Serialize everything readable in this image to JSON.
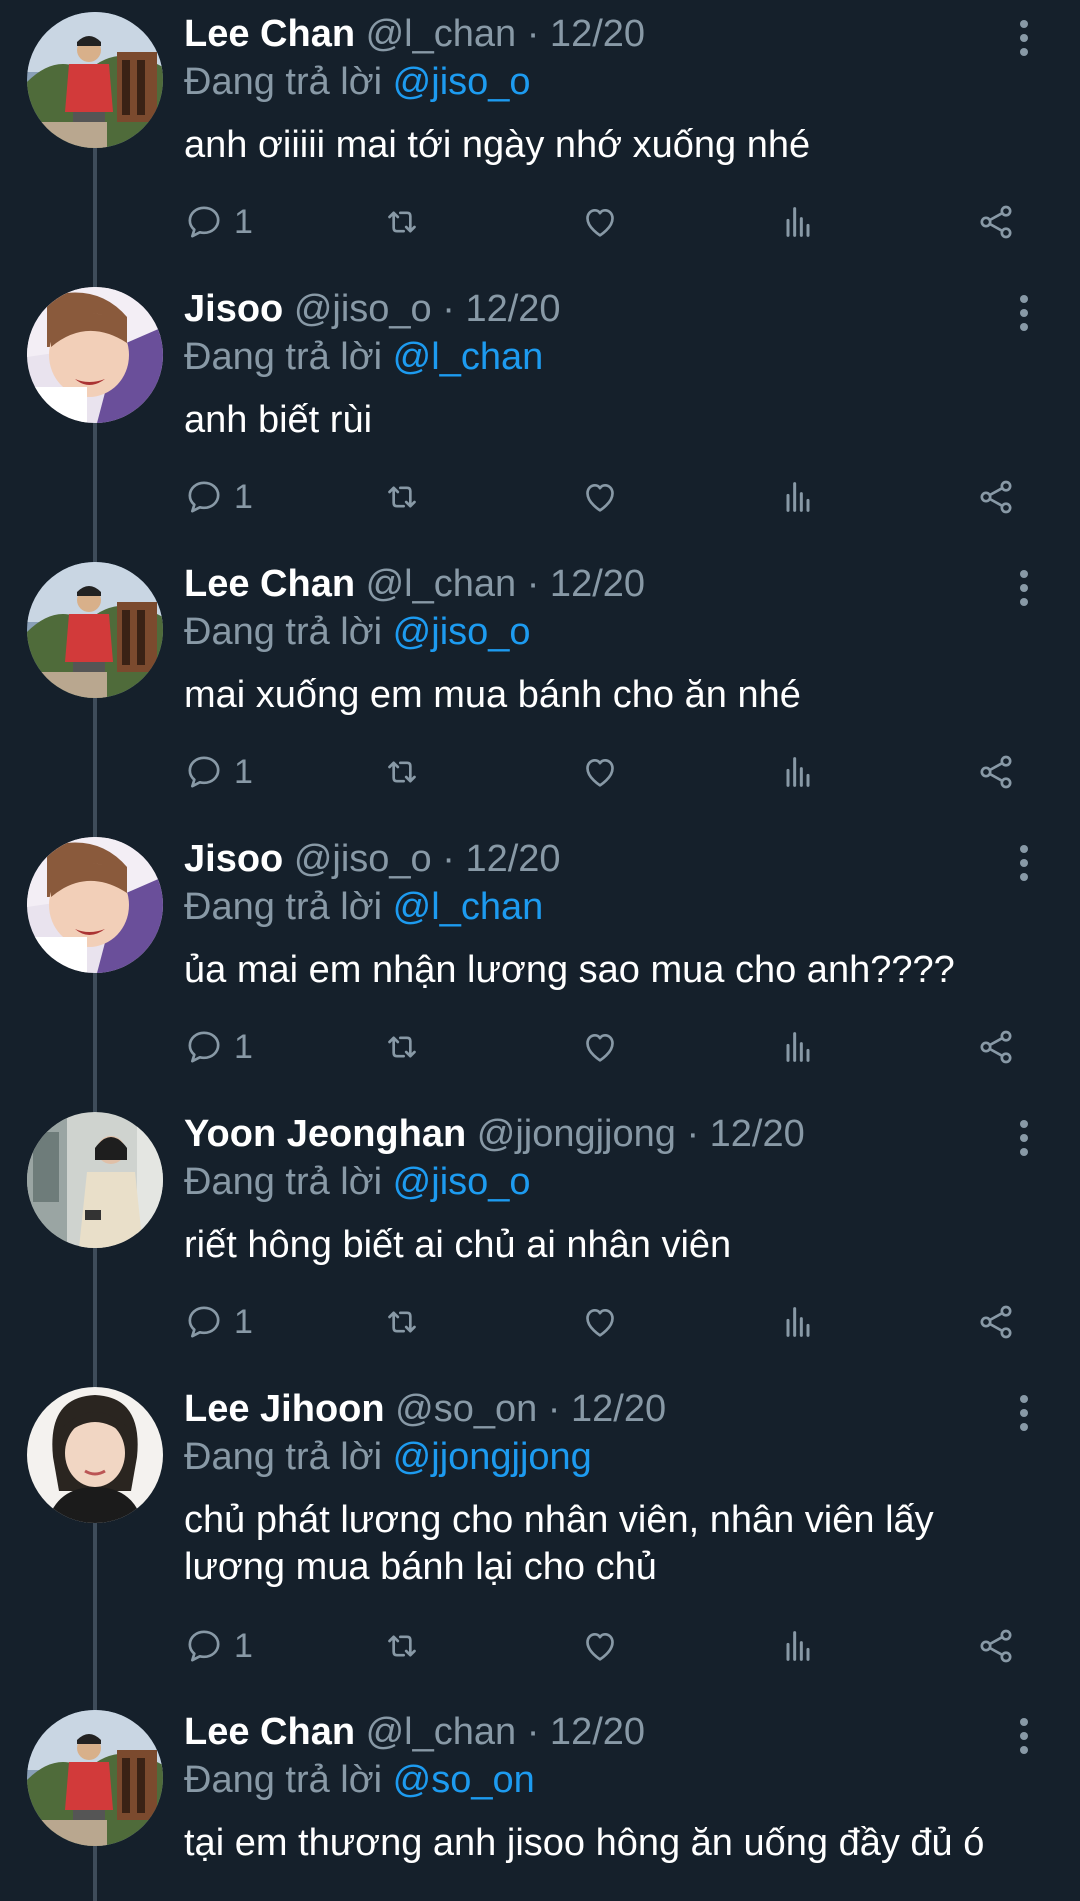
{
  "reply_prefix": "Đang trả lời",
  "tweets": [
    {
      "name": "Lee Chan",
      "meta": "@l_chan · 12/20",
      "reply_to": "@jiso_o",
      "text": "anh ơiiiii mai tới ngày nhớ xuống nhé",
      "reply_count": "1",
      "avatar": "leechan-avatar"
    },
    {
      "name": "Jisoo",
      "meta": "@jiso_o · 12/20",
      "reply_to": "@l_chan",
      "text": "anh biết rùi",
      "reply_count": "1",
      "avatar": "jisoo-avatar"
    },
    {
      "name": "Lee Chan",
      "meta": "@l_chan · 12/20",
      "reply_to": "@jiso_o",
      "text": "mai xuống em mua bánh cho ăn nhé",
      "reply_count": "1",
      "avatar": "leechan-avatar"
    },
    {
      "name": "Jisoo",
      "meta": "@jiso_o · 12/20",
      "reply_to": "@l_chan",
      "text": "ủa mai em nhận lương sao mua cho anh????",
      "reply_count": "1",
      "avatar": "jisoo-avatar"
    },
    {
      "name": "Yoon Jeonghan",
      "meta": "@jjongjjong · 12/20",
      "reply_to": "@jiso_o",
      "text": "riết hông biết ai chủ ai nhân viên",
      "reply_count": "1",
      "avatar": "jeonghan-avatar"
    },
    {
      "name": "Lee Jihoon",
      "meta": "@so_on · 12/20",
      "reply_to": "@jjongjjong",
      "text": "chủ phát lương cho nhân viên, nhân viên lấy lương mua bánh lại cho chủ",
      "reply_count": "1",
      "avatar": "jihoon-avatar"
    },
    {
      "name": "Lee Chan",
      "meta": "@l_chan · 12/20",
      "reply_to": "@so_on",
      "text": "tại em thương anh jisoo hông ăn uống đầy đủ ó",
      "reply_count": "",
      "avatar": "leechan-avatar"
    }
  ],
  "colors": {
    "background": "#15202b",
    "secondary_text": "#8899a6",
    "mention": "#1d9bf0",
    "thread_line": "#3e4c5a"
  }
}
